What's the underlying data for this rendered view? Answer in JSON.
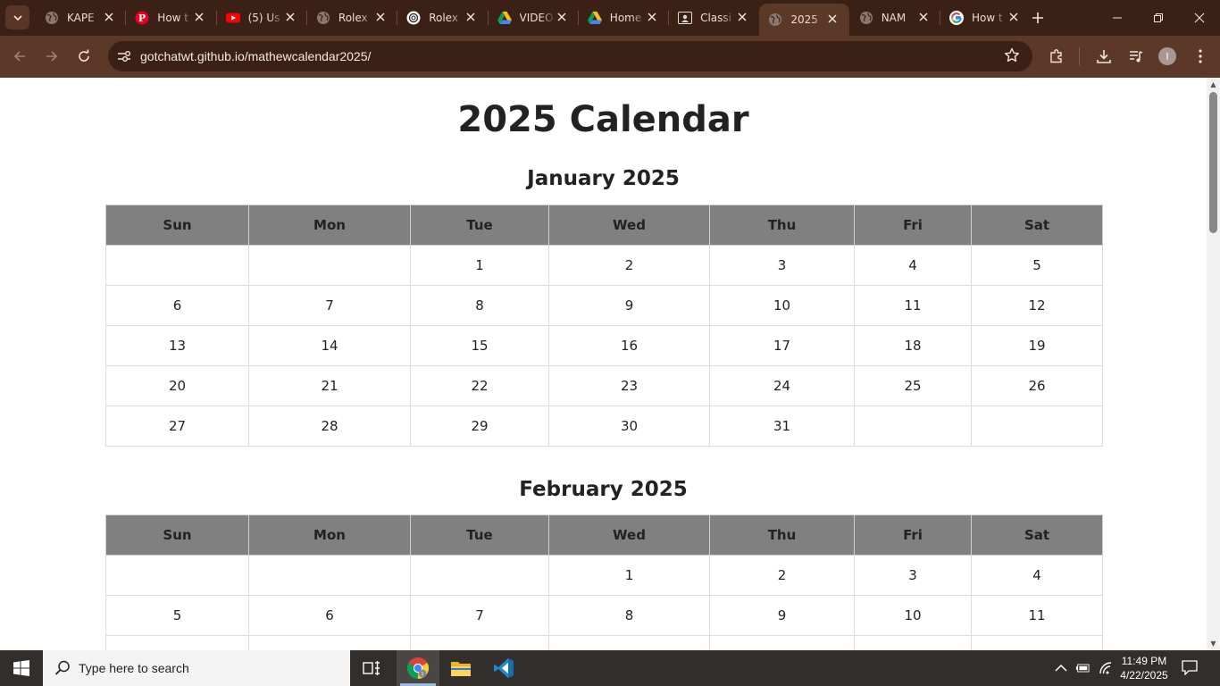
{
  "browser": {
    "tabs": [
      {
        "title": "KAPE",
        "icon": "globe-icon",
        "active": false
      },
      {
        "title": "How t",
        "icon": "pinterest-icon",
        "active": false
      },
      {
        "title": "(5) Us",
        "icon": "youtube-icon",
        "active": false
      },
      {
        "title": "Rolex",
        "icon": "globe-icon",
        "active": false
      },
      {
        "title": "Rolex",
        "icon": "openai-icon",
        "active": false
      },
      {
        "title": "VIDEO",
        "icon": "google-drive-icon",
        "active": false
      },
      {
        "title": "Home",
        "icon": "google-drive-icon",
        "active": false
      },
      {
        "title": "Classi",
        "icon": "classroom-icon",
        "active": false
      },
      {
        "title": "2025",
        "icon": "globe-icon",
        "active": true
      },
      {
        "title": "NAM",
        "icon": "globe-icon",
        "active": false
      },
      {
        "title": "How t",
        "icon": "google-icon",
        "active": false
      }
    ],
    "url": "gotchatwt.github.io/mathewcalendar2025/",
    "profile_initial": "I"
  },
  "page": {
    "title": "2025 Calendar",
    "weekdays": [
      "Sun",
      "Mon",
      "Tue",
      "Wed",
      "Thu",
      "Fri",
      "Sat"
    ],
    "months": [
      {
        "title": "January 2025",
        "weeks": [
          [
            "",
            "",
            "1",
            "2",
            "3",
            "4",
            "5"
          ],
          [
            "6",
            "7",
            "8",
            "9",
            "10",
            "11",
            "12"
          ],
          [
            "13",
            "14",
            "15",
            "16",
            "17",
            "18",
            "19"
          ],
          [
            "20",
            "21",
            "22",
            "23",
            "24",
            "25",
            "26"
          ],
          [
            "27",
            "28",
            "29",
            "30",
            "31",
            "",
            ""
          ]
        ]
      },
      {
        "title": "February 2025",
        "weeks": [
          [
            "",
            "",
            "",
            "1",
            "2",
            "3",
            "4"
          ],
          [
            "5",
            "6",
            "7",
            "8",
            "9",
            "10",
            "11"
          ],
          [
            "",
            "",
            "",
            "",
            "",
            "",
            ""
          ]
        ]
      }
    ]
  },
  "taskbar": {
    "search_placeholder": "Type here to search",
    "time": "11:49 PM",
    "date": "4/22/2025"
  },
  "colors": {
    "tabbar_bg": "#3b2016",
    "toolbar_bg": "#5c3829",
    "header_cell_bg": "#808080",
    "taskbar_bg": "#322e2b"
  }
}
